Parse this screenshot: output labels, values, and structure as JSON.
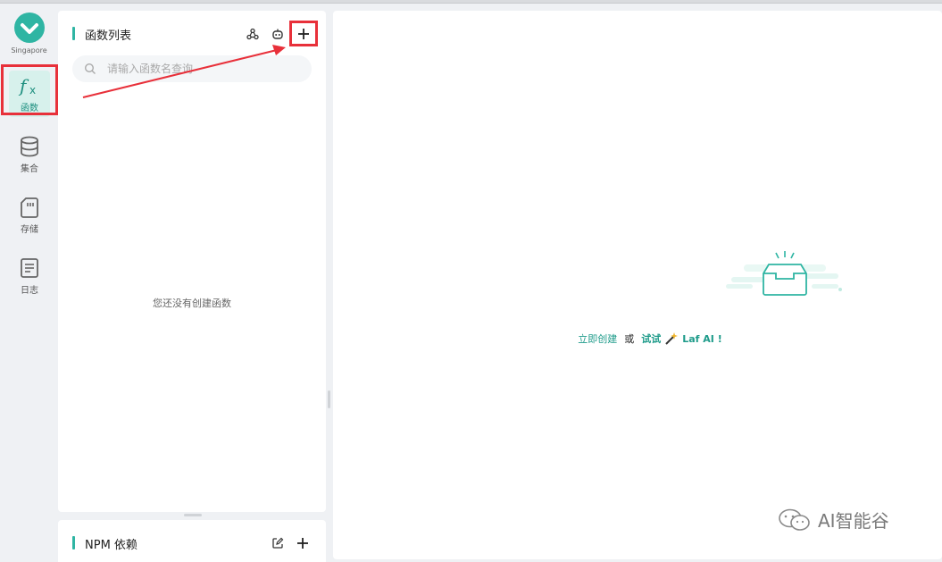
{
  "nav": {
    "region": "Singapore",
    "items": [
      {
        "label": "函数",
        "icon": "function-icon"
      },
      {
        "label": "集合",
        "icon": "database-icon"
      },
      {
        "label": "存储",
        "icon": "storage-card-icon"
      },
      {
        "label": "日志",
        "icon": "log-document-icon"
      }
    ]
  },
  "functions_panel": {
    "title": "函数列表",
    "toolbar_icons": [
      "webhook-icon",
      "bot-icon",
      "plus-icon"
    ],
    "search": {
      "placeholder": "请输入函数名查询",
      "value": ""
    },
    "empty_message": "您还没有创建函数"
  },
  "npm_panel": {
    "title": "NPM 依赖",
    "toolbar_icons": [
      "edit-icon",
      "plus-icon"
    ]
  },
  "main": {
    "create_link": "立即创建",
    "or_text": "或",
    "try_text": "试试",
    "ai_link": "Laf AI !"
  },
  "watermark": {
    "text": "AI智能谷"
  },
  "colors": {
    "accent": "#2fb5a3",
    "highlight_box": "#e8303a",
    "link": "#1e9b8a"
  }
}
